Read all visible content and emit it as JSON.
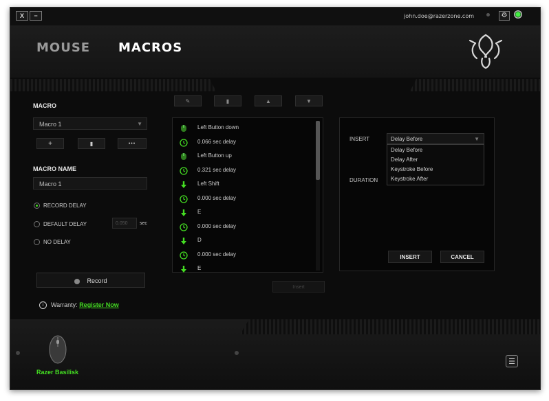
{
  "topbar": {
    "close_label": "X",
    "minimize_label": "−",
    "email": "john.doe@razerzone.com",
    "settings_icon": "⚙"
  },
  "header": {
    "tabs": [
      {
        "label": "MOUSE",
        "active": false
      },
      {
        "label": "MACROS",
        "active": true
      }
    ]
  },
  "macro": {
    "section_label": "MACRO",
    "selected": "Macro 1",
    "add_label": "+",
    "delete_label": "▮",
    "more_label": "•••",
    "name_label": "MACRO NAME",
    "name_value": "Macro 1",
    "record_options": [
      {
        "label": "RECORD DELAY",
        "selected": true
      },
      {
        "label": "DEFAULT DELAY",
        "selected": false
      },
      {
        "label": "NO DELAY",
        "selected": false
      }
    ],
    "default_delay_value": "0.050",
    "default_delay_unit": "sec",
    "record_button": "Record"
  },
  "warranty": {
    "label": "Warranty:",
    "link": "Register Now"
  },
  "toolbar": {
    "edit_icon": "✎",
    "delete_icon": "▮",
    "up_icon": "▲",
    "down_icon": "▼"
  },
  "macro_list": [
    {
      "type": "mouse",
      "text": "Left Button down"
    },
    {
      "type": "delay",
      "text": "0.066 sec delay"
    },
    {
      "type": "mouse",
      "text": "Left Button up"
    },
    {
      "type": "delay",
      "text": "0.321 sec delay"
    },
    {
      "type": "key",
      "text": "Left Shift"
    },
    {
      "type": "delay",
      "text": "0.000 sec delay"
    },
    {
      "type": "key",
      "text": "E"
    },
    {
      "type": "delay",
      "text": "0.000 sec delay"
    },
    {
      "type": "key",
      "text": "D"
    },
    {
      "type": "delay",
      "text": "0.000 sec delay"
    },
    {
      "type": "key",
      "text": "E"
    }
  ],
  "insert_bottom_label": "Insert",
  "insert_panel": {
    "insert_label": "INSERT",
    "selected": "Delay Before",
    "options": [
      "Delay Before",
      "Delay After",
      "Keystroke Before",
      "Keystroke After"
    ],
    "duration_label": "DURATION",
    "insert_button": "INSERT",
    "cancel_button": "CANCEL"
  },
  "device": {
    "name": "Razer Basilisk",
    "menu_icon": "☰"
  },
  "colors": {
    "accent": "#44dd22",
    "background": "#0c0c0c"
  }
}
